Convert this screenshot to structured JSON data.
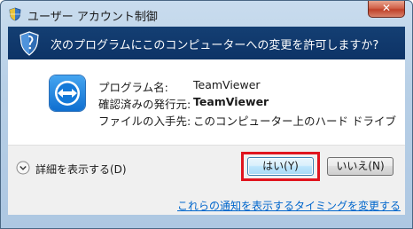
{
  "window": {
    "title": "ユーザー アカウント制御",
    "close_label": "✕"
  },
  "header": {
    "question": "次のプログラムにこのコンピューターへの変更を許可しますか?"
  },
  "program": {
    "icon": "teamviewer-icon",
    "rows": [
      {
        "label": "プログラム名:",
        "value": "TeamViewer"
      },
      {
        "label": "確認済みの発行元:",
        "value": "TeamViewer"
      },
      {
        "label": "ファイルの入手先:",
        "value": "このコンピューター上のハード ドライブ"
      }
    ]
  },
  "footer": {
    "details_label": "詳細を表示する(D)",
    "yes_label": "はい(Y)",
    "no_label": "いいえ(N)",
    "notify_link": "これらの通知を表示するタイミングを変更する"
  },
  "colors": {
    "header_bg": "#143f73",
    "link": "#0066cc",
    "highlight": "#e0141e"
  }
}
